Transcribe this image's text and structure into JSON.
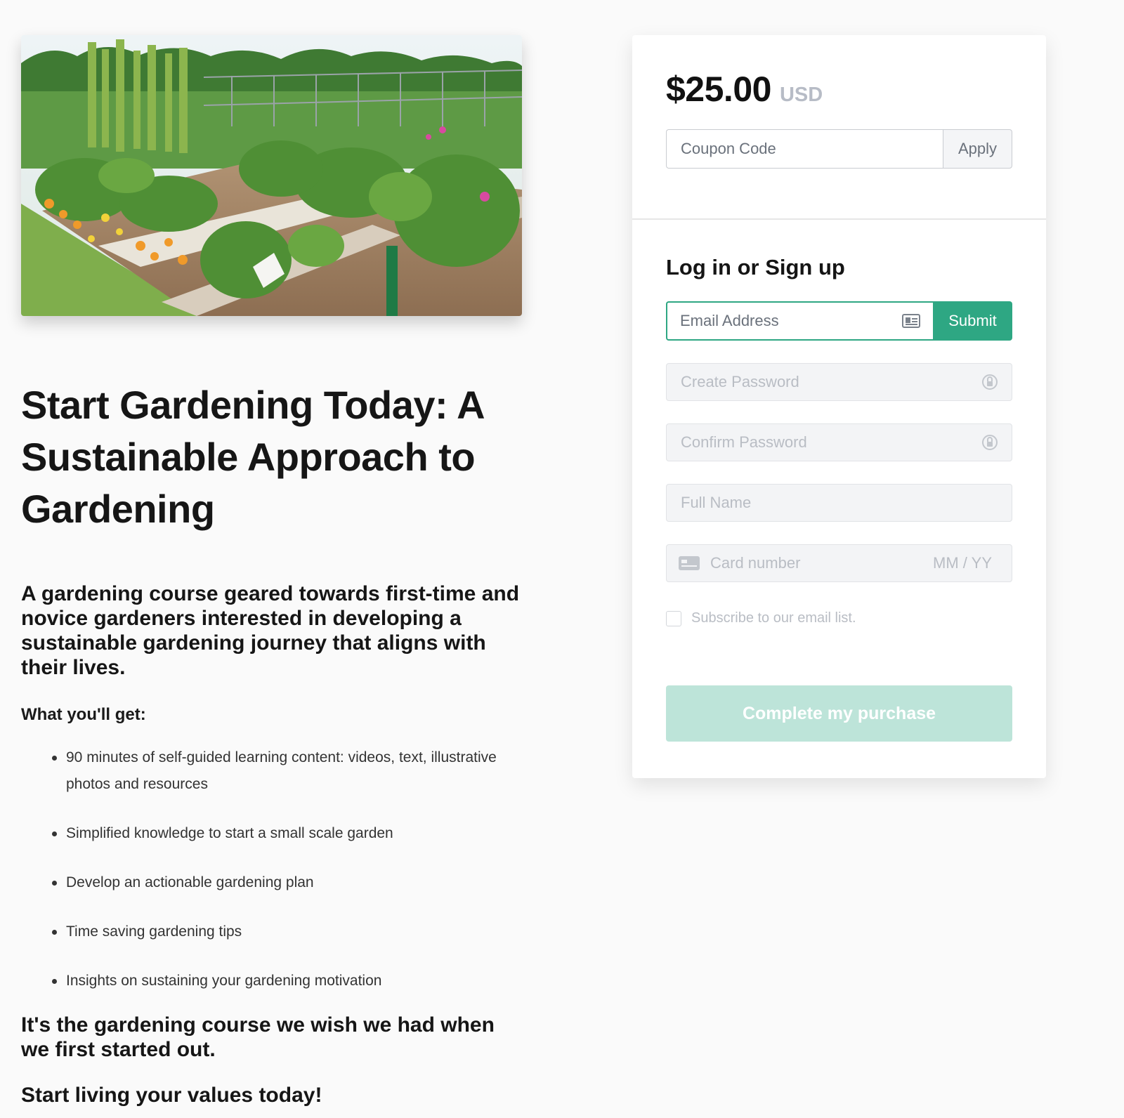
{
  "course": {
    "title": "Start Gardening Today: A Sustainable Approach to Gardening",
    "lede": "A gardening course geared towards first-time and novice gardeners interested in developing a sustainable gardening journey that aligns with their lives.",
    "what_you_get_label": "What you'll get:",
    "bullets": [
      "90 minutes of self-guided learning content: videos, text, illustrative photos and resources",
      "Simplified knowledge to start a small scale garden",
      "Develop an actionable gardening plan",
      "Time saving gardening tips",
      "Insights on sustaining your gardening motivation"
    ],
    "closing": "It's the gardening course we wish we had when we first started out.",
    "closing2": "Start living your values today!",
    "hero_image": "garden-beds-photo"
  },
  "checkout": {
    "price": "$25.00",
    "currency": "USD",
    "coupon": {
      "placeholder": "Coupon Code",
      "apply_label": "Apply"
    },
    "signup_title": "Log in or Sign up",
    "email": {
      "placeholder": "Email Address",
      "icon": "contact-card-icon",
      "submit_label": "Submit"
    },
    "create_password": {
      "placeholder": "Create Password",
      "icon": "lock-icon"
    },
    "confirm_password": {
      "placeholder": "Confirm Password",
      "icon": "lock-icon"
    },
    "full_name": {
      "placeholder": "Full Name"
    },
    "card": {
      "icon": "credit-card-icon",
      "number_placeholder": "Card number",
      "expiry_placeholder": "MM / YY"
    },
    "subscribe_label": "Subscribe to our email list.",
    "purchase_label": "Complete my purchase"
  },
  "colors": {
    "accent": "#2ea783",
    "accent_disabled": "#bde4d9",
    "page_bg": "#fafafa",
    "muted_text": "#b9bdc4"
  }
}
